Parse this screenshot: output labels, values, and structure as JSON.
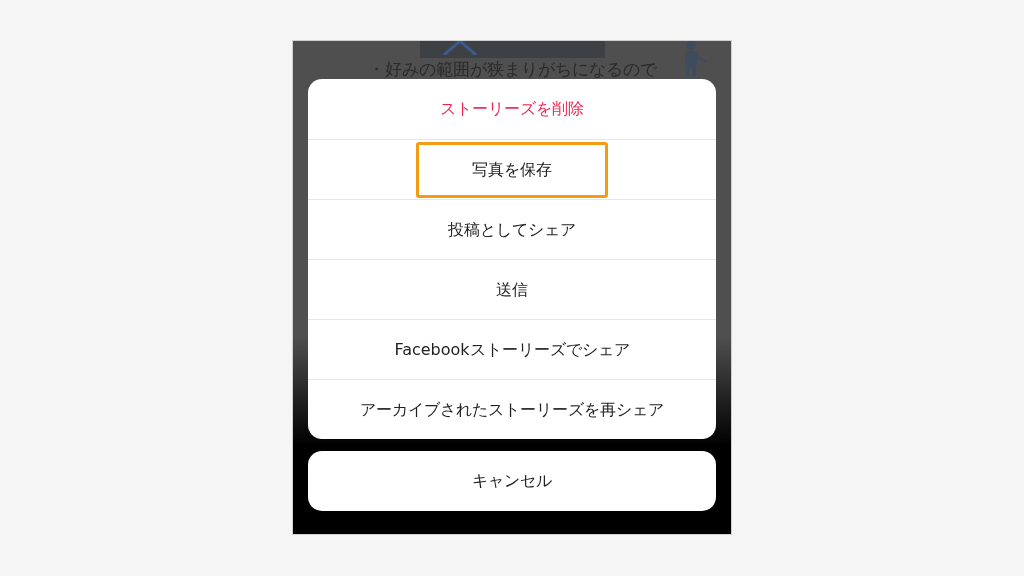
{
  "background": {
    "text": "・好みの範囲が狭まりがちになるので"
  },
  "action_sheet": {
    "items": [
      {
        "label": "ストーリーズを削除",
        "kind": "destructive",
        "highlighted": false
      },
      {
        "label": "写真を保存",
        "kind": "default",
        "highlighted": true
      },
      {
        "label": "投稿としてシェア",
        "kind": "default",
        "highlighted": false
      },
      {
        "label": "送信",
        "kind": "default",
        "highlighted": false
      },
      {
        "label": "Facebookストーリーズでシェア",
        "kind": "default",
        "highlighted": false
      },
      {
        "label": "アーカイブされたストーリーズを再シェア",
        "kind": "default",
        "highlighted": false
      }
    ]
  },
  "cancel_button": {
    "label": "キャンセル"
  }
}
